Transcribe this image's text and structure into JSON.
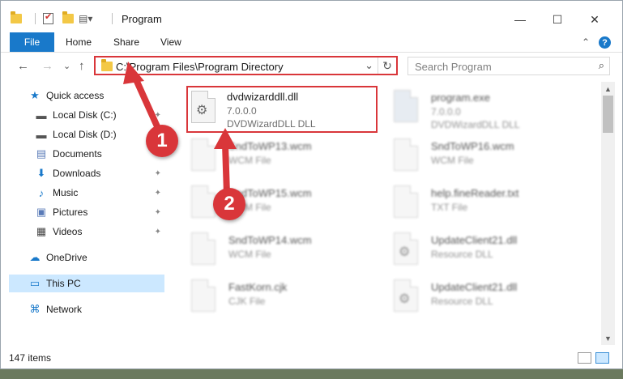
{
  "titlebar": {
    "title": "Program",
    "minimize": "—",
    "maximize": "☐",
    "close": "✕"
  },
  "ribbon": {
    "tabs": [
      "File",
      "Home",
      "Share",
      "View"
    ],
    "help": "?",
    "collapse": "⌃"
  },
  "nav_buttons": {
    "back": "←",
    "forward": "→",
    "dropdown": "⌄",
    "up": "↑"
  },
  "address": {
    "path": "C:\\Program Files\\Program Directory",
    "dropdown": "⌄",
    "refresh": "↻"
  },
  "search": {
    "placeholder": "Search Program",
    "icon": "⌕"
  },
  "sidebar": {
    "items": [
      {
        "label": "Quick access",
        "icon": "★"
      },
      {
        "label": "Local Disk (C:)",
        "icon": "▬"
      },
      {
        "label": "Local Disk (D:)",
        "icon": "▬"
      },
      {
        "label": "Documents",
        "icon": "▤"
      },
      {
        "label": "Downloads",
        "icon": "⬇"
      },
      {
        "label": "Music",
        "icon": "♪"
      },
      {
        "label": "Pictures",
        "icon": "▣"
      },
      {
        "label": "Videos",
        "icon": "▦"
      },
      {
        "label": "OneDrive",
        "icon": "☁"
      },
      {
        "label": "This PC",
        "icon": "▭"
      },
      {
        "label": "Network",
        "icon": "⌘"
      }
    ],
    "pin": "📌"
  },
  "files": [
    {
      "name": "dvdwizarddll.dll",
      "line2": "7.0.0.0",
      "line3": "DVDWizardDLL DLL"
    },
    {
      "name": "program.exe",
      "line2": "7.0.0.0",
      "line3": "DVDWizardDLL DLL"
    },
    {
      "name": "SndToWP13.wcm",
      "line2": "WCM File"
    },
    {
      "name": "SndToWP16.wcm",
      "line2": "WCM File"
    },
    {
      "name": "SndToWP15.wcm",
      "line2": "WCM File"
    },
    {
      "name": "help.fineReader.txt",
      "line2": "TXT File"
    },
    {
      "name": "SndToWP14.wcm",
      "line2": "WCM File"
    },
    {
      "name": "UpdateClient21.dll",
      "line2": "Resource DLL"
    },
    {
      "name": "FastKorn.cjk",
      "line2": "CJK File"
    },
    {
      "name": "UpdateClient21.dll",
      "line2": "Resource DLL"
    }
  ],
  "status": {
    "count": "147 items"
  },
  "annotations": {
    "badge1": "1",
    "badge2": "2",
    "color": "#d9363a"
  },
  "colors": {
    "accent": "#1979ca",
    "selection": "#cce8ff",
    "highlight": "#d9363a"
  }
}
